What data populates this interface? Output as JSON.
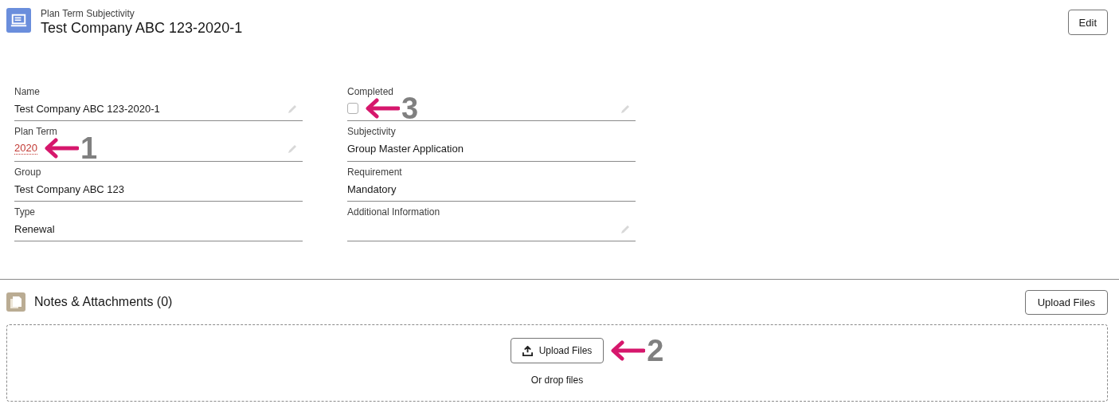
{
  "header": {
    "object_type": "Plan Term Subjectivity",
    "title": "Test Company ABC 123-2020-1",
    "edit_button": "Edit"
  },
  "columns": [
    {
      "fields": [
        {
          "label": "Name",
          "kind": "text",
          "value": "Test Company ABC 123-2020-1",
          "editable": true
        },
        {
          "label": "Plan Term",
          "kind": "link",
          "value": "2020",
          "editable": true,
          "callout": "1"
        },
        {
          "label": "Group",
          "kind": "text",
          "value": "Test Company ABC 123",
          "editable": false
        },
        {
          "label": "Type",
          "kind": "text",
          "value": "Renewal",
          "editable": false
        }
      ]
    },
    {
      "fields": [
        {
          "label": "Completed",
          "kind": "checkbox",
          "checked": false,
          "editable": true,
          "callout": "3"
        },
        {
          "label": "Subjectivity",
          "kind": "text",
          "value": "Group Master Application",
          "editable": false
        },
        {
          "label": "Requirement",
          "kind": "text",
          "value": "Mandatory",
          "editable": false
        },
        {
          "label": "Additional Information",
          "kind": "text",
          "editable": true
        }
      ]
    }
  ],
  "notes": {
    "title": "Notes & Attachments (0)",
    "upload_button": "Upload Files",
    "dropzone": {
      "button": "Upload Files",
      "callout": "2",
      "hint": "Or drop files"
    }
  }
}
